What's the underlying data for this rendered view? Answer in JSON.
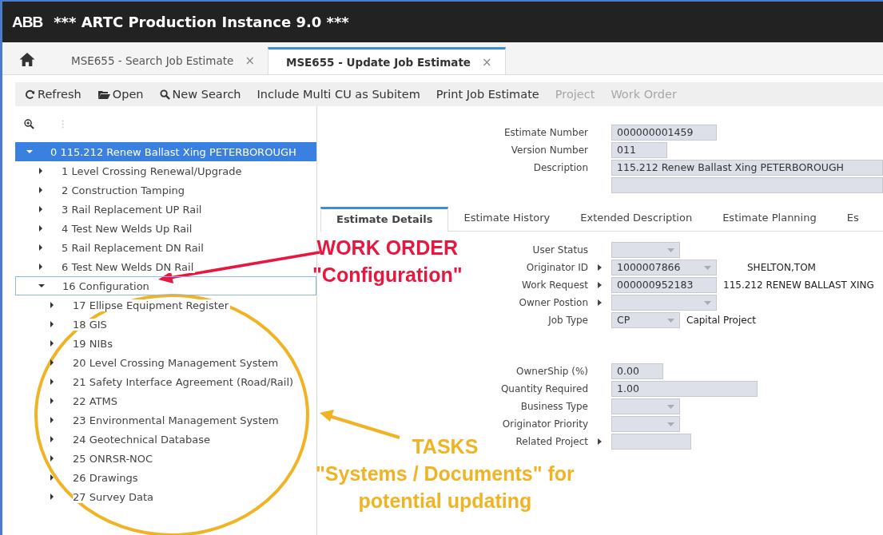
{
  "window": {
    "logo": "ABB",
    "title": "*** ARTC Production Instance 9.0 ***"
  },
  "tabs": [
    {
      "label": "MSE655 - Search Job Estimate",
      "selected": false,
      "close": "×"
    },
    {
      "label": "MSE655 - Update Job Estimate",
      "selected": true,
      "close": "×"
    }
  ],
  "toolbar": [
    {
      "label": "Refresh",
      "disabled": false
    },
    {
      "label": "Open",
      "disabled": false
    },
    {
      "label": "New Search",
      "disabled": false
    },
    {
      "label": "Include Multi CU as Subitem",
      "disabled": false
    },
    {
      "label": "Print Job Estimate",
      "disabled": false
    },
    {
      "label": "Project",
      "disabled": true
    },
    {
      "label": "Work Order",
      "disabled": true
    }
  ],
  "tree": [
    {
      "label": "0 115.212 Renew Ballast Xing PETERBOROUGH",
      "expanded": true,
      "selected": true,
      "focused": false,
      "children": [
        {
          "label": "1 Level Crossing Renewal/Upgrade",
          "expanded": false,
          "selected": false,
          "focused": false
        },
        {
          "label": "2 Construction Tamping",
          "expanded": false,
          "selected": false,
          "focused": false
        },
        {
          "label": "3 Rail Replacement UP Rail",
          "expanded": false,
          "selected": false,
          "focused": false
        },
        {
          "label": "4 Test New Welds Up Rail",
          "expanded": false,
          "selected": false,
          "focused": false
        },
        {
          "label": "5 Rail Replacement DN Rail",
          "expanded": false,
          "selected": false,
          "focused": false
        },
        {
          "label": "6 Test New Welds DN Rail",
          "expanded": false,
          "selected": false,
          "focused": false
        },
        {
          "label": "16 Configuration",
          "expanded": true,
          "selected": false,
          "focused": true,
          "children": [
            {
              "label": "17 Ellipse Equipment Register",
              "expanded": false,
              "selected": false,
              "focused": false
            },
            {
              "label": "18 GIS",
              "expanded": false,
              "selected": false,
              "focused": false
            },
            {
              "label": "19 NIBs",
              "expanded": false,
              "selected": false,
              "focused": false
            },
            {
              "label": "20 Level Crossing Management System",
              "expanded": false,
              "selected": false,
              "focused": false
            },
            {
              "label": "21 Safety Interface Agreement (Road/Rail)",
              "expanded": false,
              "selected": false,
              "focused": false
            },
            {
              "label": "22 ATMS",
              "expanded": false,
              "selected": false,
              "focused": false
            },
            {
              "label": "23 Environmental Management System",
              "expanded": false,
              "selected": false,
              "focused": false
            },
            {
              "label": "24 Geotechnical Database",
              "expanded": false,
              "selected": false,
              "focused": false
            },
            {
              "label": "25 ONRSR-NOC",
              "expanded": false,
              "selected": false,
              "focused": false
            },
            {
              "label": "26 Drawings",
              "expanded": false,
              "selected": false,
              "focused": false
            },
            {
              "label": "27 Survey Data",
              "expanded": false,
              "selected": false,
              "focused": false
            }
          ]
        }
      ]
    }
  ],
  "header_fields": [
    {
      "label": "Estimate Number",
      "value": "000000001459"
    },
    {
      "label": "Version Number",
      "value": "011"
    },
    {
      "label": "Description",
      "value": "115.212 Renew Ballast Xing PETERBOROUGH"
    }
  ],
  "detail_tabs": [
    {
      "label": "Estimate Details",
      "selected": true
    },
    {
      "label": "Estimate History",
      "selected": false
    },
    {
      "label": "Extended Description",
      "selected": false
    },
    {
      "label": "Estimate Planning",
      "selected": false
    },
    {
      "label": "Es",
      "selected": false
    }
  ],
  "detail_groups": [
    [
      {
        "label": "User Status",
        "kind": "dropdown",
        "link": false
      },
      {
        "label": "Originator ID",
        "kind": "dropdown",
        "link": true,
        "value": "1000007866",
        "note": "SHELTON,TOM"
      },
      {
        "label": "Work Request",
        "kind": "text",
        "link": true,
        "value": "000000952183",
        "note": "115.212 RENEW BALLAST XING"
      },
      {
        "label": "Owner Postion",
        "kind": "dropdown",
        "link": true
      },
      {
        "label": "Job Type",
        "kind": "dropdown",
        "link": false,
        "value": "CP",
        "note": "Capital Project"
      }
    ],
    [
      {
        "label": "OwnerShip (%)",
        "kind": "text",
        "link": false,
        "value": "0.00"
      },
      {
        "label": "Quantity Required",
        "kind": "text",
        "link": false,
        "value": "1.00"
      },
      {
        "label": "Business Type",
        "kind": "dropdown",
        "link": false
      },
      {
        "label": "Originator Priority",
        "kind": "dropdown",
        "link": false
      },
      {
        "label": "Related Project",
        "kind": "text",
        "link": true
      }
    ]
  ],
  "annotations": [
    {
      "kind": "red",
      "lines": [
        "WORK ORDER",
        "\"Configuration\""
      ]
    },
    {
      "kind": "yellow",
      "lines": [
        "TASKS",
        "\"Systems / Documents\" for",
        "potential updating"
      ]
    }
  ]
}
